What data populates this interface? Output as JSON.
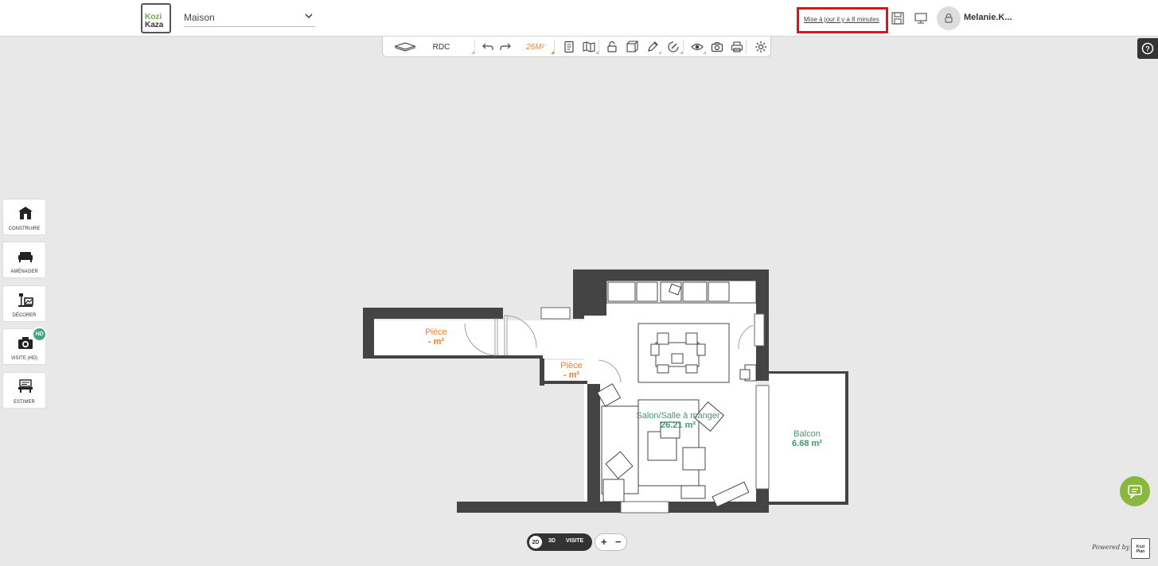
{
  "app": {
    "logo_line1": "Kozi",
    "logo_line2": "Kaza",
    "project_name": "Maison"
  },
  "header": {
    "update_status": "Mise à jour il y a 8 minutes",
    "username": "Melanie.K...",
    "icons": [
      "save-icon",
      "monitor-icon",
      "user-icon"
    ]
  },
  "toolbar": {
    "level_label": "RDC",
    "area_label": "26M²",
    "accent_color": "#f07d2c",
    "icons": [
      "floor-icon",
      "undo-icon",
      "redo-icon",
      "document-icon",
      "map-icon",
      "lock-icon",
      "cube-icon",
      "pencil-icon",
      "paint-icon",
      "eye-icon",
      "camera-icon",
      "print-icon",
      "settings-icon"
    ]
  },
  "side_tools": [
    {
      "label": "CONSTRUIRE",
      "icon": "house-icon"
    },
    {
      "label": "AMÉNAGER",
      "icon": "sofa-icon"
    },
    {
      "label": "DÉCORER",
      "icon": "lamp-icon"
    },
    {
      "label": "VISITE (HD)",
      "icon": "camera-icon",
      "badge": "HD"
    },
    {
      "label": "ESTIMER",
      "icon": "estimate-icon"
    }
  ],
  "plan": {
    "rooms": [
      {
        "name": "Pièce",
        "area": "- m²",
        "color": "#f07d2c"
      },
      {
        "name": "Pièce",
        "area": "- m²",
        "color": "#f07d2c"
      },
      {
        "name": "Salon/Salle à manger",
        "area": "26.21 m²",
        "color": "#3e9b6f"
      },
      {
        "name": "Balcon",
        "area": "6.68 m²",
        "color": "#3e9b6f"
      }
    ]
  },
  "view": {
    "mode_2d": "2D",
    "mode_3d": "3D",
    "mode_visite": "VISITE",
    "zoom_in": "+",
    "zoom_out": "−"
  },
  "footer": {
    "powered_by": "Powered by",
    "powered_logo_line1": "Kozi",
    "powered_logo_line2": "Plan",
    "chat_color": "#8ab83e"
  }
}
